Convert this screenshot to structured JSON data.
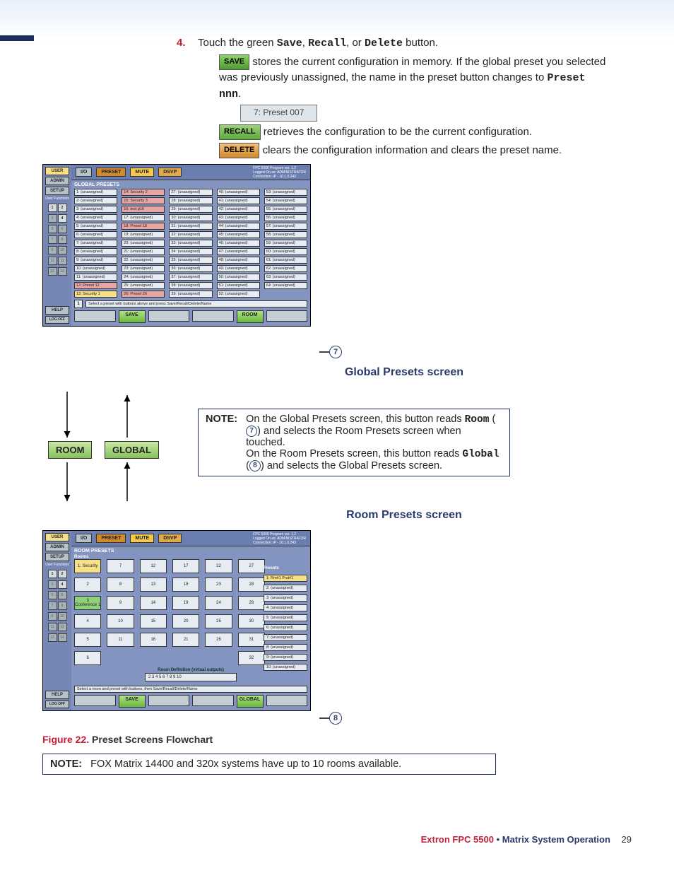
{
  "step": {
    "number": "4",
    "text_prefix": "Touch the green ",
    "save": "Save",
    "recall": "Recall",
    "delete": "Delete",
    "text_middle": " button.",
    "save_btn": "SAVE",
    "save_desc": " stores the current configuration in memory. If the global preset you selected was previously unassigned, the name in the preset button changes to ",
    "preset_nnn": "Preset nnn",
    "preset_example": "7: Preset 007",
    "recall_btn": "RECALL",
    "recall_desc": " retrieves the configuration to be the current configuration.",
    "delete_btn": "DELETE",
    "delete_desc": " clears the configuration information and clears the preset name."
  },
  "flow_buttons": {
    "room": "ROOM",
    "global": "GLOBAL"
  },
  "header_info": {
    "line1": "FPC 5000 Program  ver. 1.2",
    "line2": "Logged On as: ADMINISTRATOR",
    "line3": "Connection: IP - 10.1.0.243"
  },
  "sidebar": {
    "user": "USER",
    "admin": "ADMIN",
    "setup": "SETUP",
    "userfns": "User\nFunctions",
    "help": "HELP",
    "logoff": "LOG\nOFF"
  },
  "toolbar": {
    "io": "I/O",
    "preset": "PRESET",
    "mute": "MUTE",
    "dsvp": "DSVP"
  },
  "global": {
    "title": "GLOBAL PRESETS",
    "status_num": "1",
    "status": "Select a preset with buttons above and press Save/Recall/Delete/Name",
    "save": "SAVE",
    "room": "ROOM",
    "presets": [
      {
        "n": "1",
        "label": "(unassigned)",
        "c": ""
      },
      {
        "n": "2",
        "label": "(unassigned)",
        "c": ""
      },
      {
        "n": "3",
        "label": "(unassigned)",
        "c": ""
      },
      {
        "n": "4",
        "label": "(unassigned)",
        "c": ""
      },
      {
        "n": "5",
        "label": "(unassigned)",
        "c": ""
      },
      {
        "n": "6",
        "label": "(unassigned)",
        "c": ""
      },
      {
        "n": "7",
        "label": "(unassigned)",
        "c": ""
      },
      {
        "n": "8",
        "label": "(unassigned)",
        "c": ""
      },
      {
        "n": "9",
        "label": "(unassigned)",
        "c": ""
      },
      {
        "n": "10",
        "label": "(unassigned)",
        "c": ""
      },
      {
        "n": "11",
        "label": "(unassigned)",
        "c": ""
      },
      {
        "n": "12",
        "label": "Preset 12",
        "c": "red"
      },
      {
        "n": "13",
        "label": "Security 1",
        "c": "yellow"
      },
      {
        "n": "14",
        "label": "Security 2",
        "c": "red"
      },
      {
        "n": "15",
        "label": "Security 3",
        "c": "red"
      },
      {
        "n": "16",
        "label": "test p16",
        "c": "red"
      },
      {
        "n": "17",
        "label": "(unassigned)",
        "c": ""
      },
      {
        "n": "18",
        "label": "Preset 18",
        "c": "red"
      },
      {
        "n": "19",
        "label": "(unassigned)",
        "c": ""
      },
      {
        "n": "20",
        "label": "(unassigned)",
        "c": ""
      },
      {
        "n": "21",
        "label": "(unassigned)",
        "c": ""
      },
      {
        "n": "22",
        "label": "(unassigned)",
        "c": ""
      },
      {
        "n": "23",
        "label": "(unassigned)",
        "c": ""
      },
      {
        "n": "24",
        "label": "(unassigned)",
        "c": ""
      },
      {
        "n": "25",
        "label": "(unassigned)",
        "c": ""
      },
      {
        "n": "26",
        "label": "Preset 26",
        "c": "red"
      },
      {
        "n": "27",
        "label": "(unassigned)",
        "c": ""
      },
      {
        "n": "28",
        "label": "(unassigned)",
        "c": ""
      },
      {
        "n": "29",
        "label": "(unassigned)",
        "c": ""
      },
      {
        "n": "30",
        "label": "(unassigned)",
        "c": ""
      },
      {
        "n": "31",
        "label": "(unassigned)",
        "c": ""
      },
      {
        "n": "32",
        "label": "(unassigned)",
        "c": ""
      },
      {
        "n": "33",
        "label": "(unassigned)",
        "c": ""
      },
      {
        "n": "34",
        "label": "(unassigned)",
        "c": ""
      },
      {
        "n": "35",
        "label": "(unassigned)",
        "c": ""
      },
      {
        "n": "36",
        "label": "(unassigned)",
        "c": ""
      },
      {
        "n": "37",
        "label": "(unassigned)",
        "c": ""
      },
      {
        "n": "38",
        "label": "(unassigned)",
        "c": ""
      },
      {
        "n": "39",
        "label": "(unassigned)",
        "c": ""
      },
      {
        "n": "40",
        "label": "(unassigned)",
        "c": ""
      },
      {
        "n": "41",
        "label": "(unassigned)",
        "c": ""
      },
      {
        "n": "42",
        "label": "(unassigned)",
        "c": ""
      },
      {
        "n": "43",
        "label": "(unassigned)",
        "c": ""
      },
      {
        "n": "44",
        "label": "(unassigned)",
        "c": ""
      },
      {
        "n": "45",
        "label": "(unassigned)",
        "c": ""
      },
      {
        "n": "46",
        "label": "(unassigned)",
        "c": ""
      },
      {
        "n": "47",
        "label": "(unassigned)",
        "c": ""
      },
      {
        "n": "48",
        "label": "(unassigned)",
        "c": ""
      },
      {
        "n": "49",
        "label": "(unassigned)",
        "c": ""
      },
      {
        "n": "50",
        "label": "(unassigned)",
        "c": ""
      },
      {
        "n": "51",
        "label": "(unassigned)",
        "c": ""
      },
      {
        "n": "52",
        "label": "(unassigned)",
        "c": ""
      },
      {
        "n": "53",
        "label": "(unassigned)",
        "c": ""
      },
      {
        "n": "54",
        "label": "(unassigned)",
        "c": ""
      },
      {
        "n": "55",
        "label": "(unassigned)",
        "c": ""
      },
      {
        "n": "56",
        "label": "(unassigned)",
        "c": ""
      },
      {
        "n": "57",
        "label": "(unassigned)",
        "c": ""
      },
      {
        "n": "58",
        "label": "(unassigned)",
        "c": ""
      },
      {
        "n": "59",
        "label": "(unassigned)",
        "c": ""
      },
      {
        "n": "60",
        "label": "(unassigned)",
        "c": ""
      },
      {
        "n": "61",
        "label": "(unassigned)",
        "c": ""
      },
      {
        "n": "62",
        "label": "(unassigned)",
        "c": ""
      },
      {
        "n": "63",
        "label": "(unassigned)",
        "c": ""
      },
      {
        "n": "64",
        "label": "(unassigned)",
        "c": ""
      }
    ]
  },
  "room": {
    "title": "ROOM PRESETS",
    "rooms_hdr": "Rooms",
    "status": "Select a room and preset with buttons, then Save/Recall/Delete/Name",
    "save": "SAVE",
    "global": "GLOBAL",
    "def_label": "Room Definition (virtual outputs)",
    "def_value": "2 3 4 5 6 7 8 9 10",
    "cells": [
      {
        "t": "1: Security",
        "c": "yellow"
      },
      {
        "t": "7",
        "c": ""
      },
      {
        "t": "12",
        "c": ""
      },
      {
        "t": "17",
        "c": ""
      },
      {
        "t": "22",
        "c": ""
      },
      {
        "t": "27",
        "c": ""
      },
      {
        "t": "2",
        "c": ""
      },
      {
        "t": "8",
        "c": ""
      },
      {
        "t": "13",
        "c": ""
      },
      {
        "t": "18",
        "c": ""
      },
      {
        "t": "23",
        "c": ""
      },
      {
        "t": "28",
        "c": ""
      },
      {
        "t": "3\nConference 1",
        "c": "green"
      },
      {
        "t": "9",
        "c": ""
      },
      {
        "t": "14",
        "c": ""
      },
      {
        "t": "19",
        "c": ""
      },
      {
        "t": "24",
        "c": ""
      },
      {
        "t": "29",
        "c": ""
      },
      {
        "t": "4",
        "c": ""
      },
      {
        "t": "10",
        "c": ""
      },
      {
        "t": "15",
        "c": ""
      },
      {
        "t": "20",
        "c": ""
      },
      {
        "t": "25",
        "c": ""
      },
      {
        "t": "30",
        "c": ""
      },
      {
        "t": "5",
        "c": ""
      },
      {
        "t": "11",
        "c": ""
      },
      {
        "t": "16",
        "c": ""
      },
      {
        "t": "21",
        "c": ""
      },
      {
        "t": "26",
        "c": ""
      },
      {
        "t": "31",
        "c": ""
      },
      {
        "t": "6",
        "c": ""
      },
      {
        "t": "",
        "c": "none"
      },
      {
        "t": "",
        "c": "none"
      },
      {
        "t": "",
        "c": "none"
      },
      {
        "t": "",
        "c": "none"
      },
      {
        "t": "32",
        "c": ""
      }
    ],
    "side_hdr": "Presets",
    "side_presets": [
      {
        "t": "1: Rm#1 Prst#1",
        "c": "yellow"
      },
      {
        "t": "2: (unassigned)",
        "c": ""
      },
      {
        "t": "3: (unassigned)",
        "c": ""
      },
      {
        "t": "4: (unassigned)",
        "c": ""
      },
      {
        "t": "5: (unassigned)",
        "c": ""
      },
      {
        "t": "6: (unassigned)",
        "c": ""
      },
      {
        "t": "7: (unassigned)",
        "c": ""
      },
      {
        "t": "8: (unassigned)",
        "c": ""
      },
      {
        "t": "9: (unassigned)",
        "c": ""
      },
      {
        "t": "10: (unassigned)",
        "c": ""
      }
    ]
  },
  "captions": {
    "global": "Global Presets screen",
    "room": "Room Presets screen",
    "figure_no": "Figure 22.",
    "figure_title": "Preset Screens Flowchart"
  },
  "note_side": {
    "label": "NOTE:",
    "l1": "On the Global Presets screen, this button reads ",
    "room": "Room",
    "l2": " and selects the Room Presets screen when touched.",
    "l3": "On the Room Presets screen, this button reads ",
    "global": "Global",
    "l4": " and selects the Global Presets screen."
  },
  "note_bottom": {
    "label": "NOTE:",
    "text": "FOX Matrix 14400 and 320x systems have up to 10 rooms available."
  },
  "callouts": {
    "seven": "7",
    "eight": "8"
  },
  "footer": {
    "product": "Extron FPC 5500",
    "section": "Matrix System Operation",
    "page": "29"
  }
}
